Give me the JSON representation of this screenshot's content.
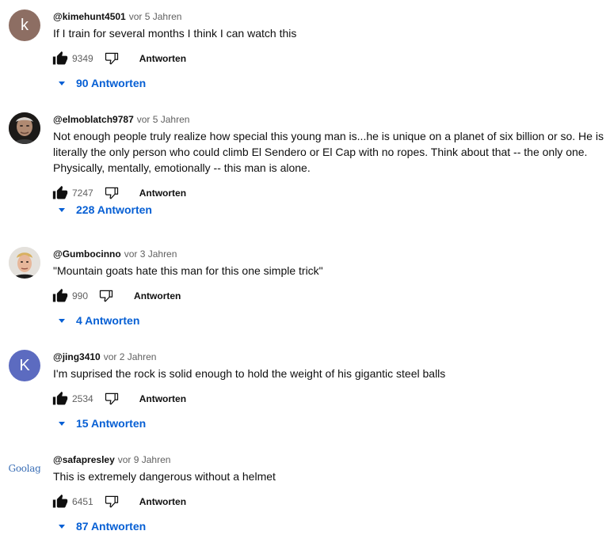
{
  "comments": [
    {
      "author": "@kimehunt4501",
      "time": "vor 5 Jahren",
      "text": "If I train for several months I think I can watch this",
      "likes": "9349",
      "reply_label": "Antworten",
      "replies_label": "90 Antworten",
      "avatar": {
        "type": "letter",
        "letter": "k",
        "color": "#8d6e63"
      }
    },
    {
      "author": "@elmoblatch9787",
      "time": "vor 5 Jahren",
      "text": "Not enough people truly realize how special this young man is...he is unique on a planet of six billion or so. He is literally the only person who could climb El Sendero or El Cap with no ropes. Think about that -- the only one. Physically, mentally, emotionally -- this man is alone.",
      "likes": "7247",
      "reply_label": "Antworten",
      "replies_label": "228 Antworten",
      "avatar": {
        "type": "photo"
      }
    },
    {
      "author": "@Gumbocinno",
      "time": "vor 3 Jahren",
      "text": "\"Mountain goats hate this man for this one simple trick\"",
      "likes": "990",
      "reply_label": "Antworten",
      "replies_label": "4 Antworten",
      "avatar": {
        "type": "photo"
      }
    },
    {
      "author": "@jing3410",
      "time": "vor 2 Jahren",
      "text": "I'm suprised the rock is solid enough to hold the weight of his gigantic steel balls",
      "likes": "2534",
      "reply_label": "Antworten",
      "replies_label": "15 Antworten",
      "avatar": {
        "type": "letter",
        "letter": "K",
        "color": "#5c6bc0"
      }
    },
    {
      "author": "@safapresley",
      "time": "vor 9 Jahren",
      "text": "This is extremely dangerous without a helmet",
      "likes": "6451",
      "reply_label": "Antworten",
      "replies_label": "87 Antworten",
      "avatar": {
        "type": "logo",
        "text": "Goolag"
      }
    }
  ],
  "colors": {
    "link": "#065fd4",
    "meta": "#606060",
    "text": "#0f0f0f"
  }
}
